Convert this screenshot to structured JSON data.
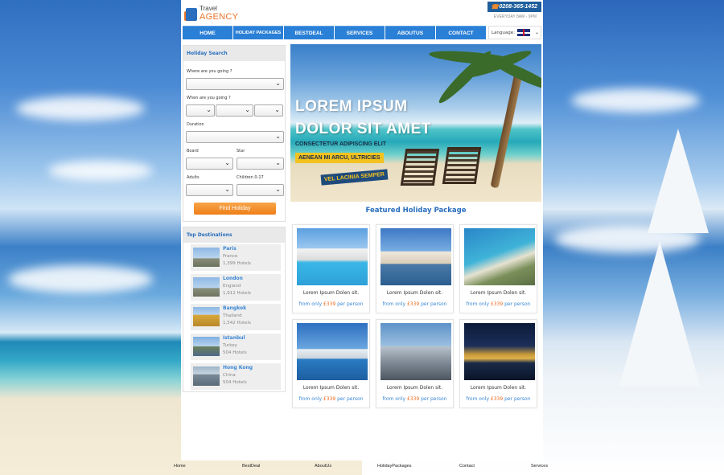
{
  "header": {
    "logo_line1": "Travel",
    "logo_line2": "AGENCY",
    "phone": "0208-365-1452",
    "hours": "EVERYDAY 8AM - 9PM"
  },
  "nav": {
    "items": [
      {
        "label": "HOME"
      },
      {
        "label": "HOLIDAY PACKAGES"
      },
      {
        "label": "BESTDEAL"
      },
      {
        "label": "SERVICES"
      },
      {
        "label": "ABOUTUS"
      },
      {
        "label": "CONTACT"
      }
    ],
    "language_label": "Language:"
  },
  "search": {
    "title": "Holiday Search",
    "where_label": "Where are you going ?",
    "when_label": "When are you going ?",
    "duration_label": "Duration",
    "board_label": "Board",
    "star_label": "Star",
    "adults_label": "Adults",
    "children_label": "Children 0-17",
    "button_label": "Find Holiday"
  },
  "destinations": {
    "title": "Top Destinations",
    "items": [
      {
        "name": "Paris",
        "country": "France",
        "hotels": "1,399 Hotels"
      },
      {
        "name": "London",
        "country": "England",
        "hotels": "1,912 Hotels"
      },
      {
        "name": "Bangkok",
        "country": "Thailand",
        "hotels": "1,542 Hotels"
      },
      {
        "name": "Istanbul",
        "country": "Turkey",
        "hotels": "504 Hotels"
      },
      {
        "name": "Hong Kong",
        "country": "China",
        "hotels": "504 Hotels"
      }
    ]
  },
  "hero": {
    "line1": "LOREM IPSUM",
    "line2": "DOLOR SIT AMET",
    "subtitle": "CONSECTETUR ADIPISCING ELIT",
    "tag1": "AENEAN MI ARCU, ULTRICIES",
    "tag2": "VEL LACINIA SEMPER"
  },
  "featured": {
    "title": "Featured Holiday Package",
    "cards": [
      {
        "title": "Lorem Ipsum Dolen sit.",
        "price_prefix": "from only ",
        "price": "£339",
        "price_suffix": " per person"
      },
      {
        "title": "Lorem Ipsum Dolen sit.",
        "price_prefix": "from only ",
        "price": "£339",
        "price_suffix": " per person"
      },
      {
        "title": "Lorem Ipsum Dolen sit.",
        "price_prefix": "from only ",
        "price": "£339",
        "price_suffix": " per person"
      },
      {
        "title": "Lorem Ipsum Dolen sit.",
        "price_prefix": "from only ",
        "price": "£339",
        "price_suffix": " per person"
      },
      {
        "title": "Lorem Ipsum Dolen sit.",
        "price_prefix": "from only ",
        "price": "£339",
        "price_suffix": " per person"
      },
      {
        "title": "Lorem Ipsum Dolen sit.",
        "price_prefix": "from only ",
        "price": "£339",
        "price_suffix": " per person"
      }
    ]
  },
  "footer": {
    "links": [
      "Home",
      "BestDeal",
      "AboutUs",
      "HolidayPackages",
      "Contact",
      "Services"
    ]
  },
  "colors": {
    "accent": "#2a7fd6",
    "orange": "#ee7f18",
    "brand_blue": "#2a6ebd"
  }
}
